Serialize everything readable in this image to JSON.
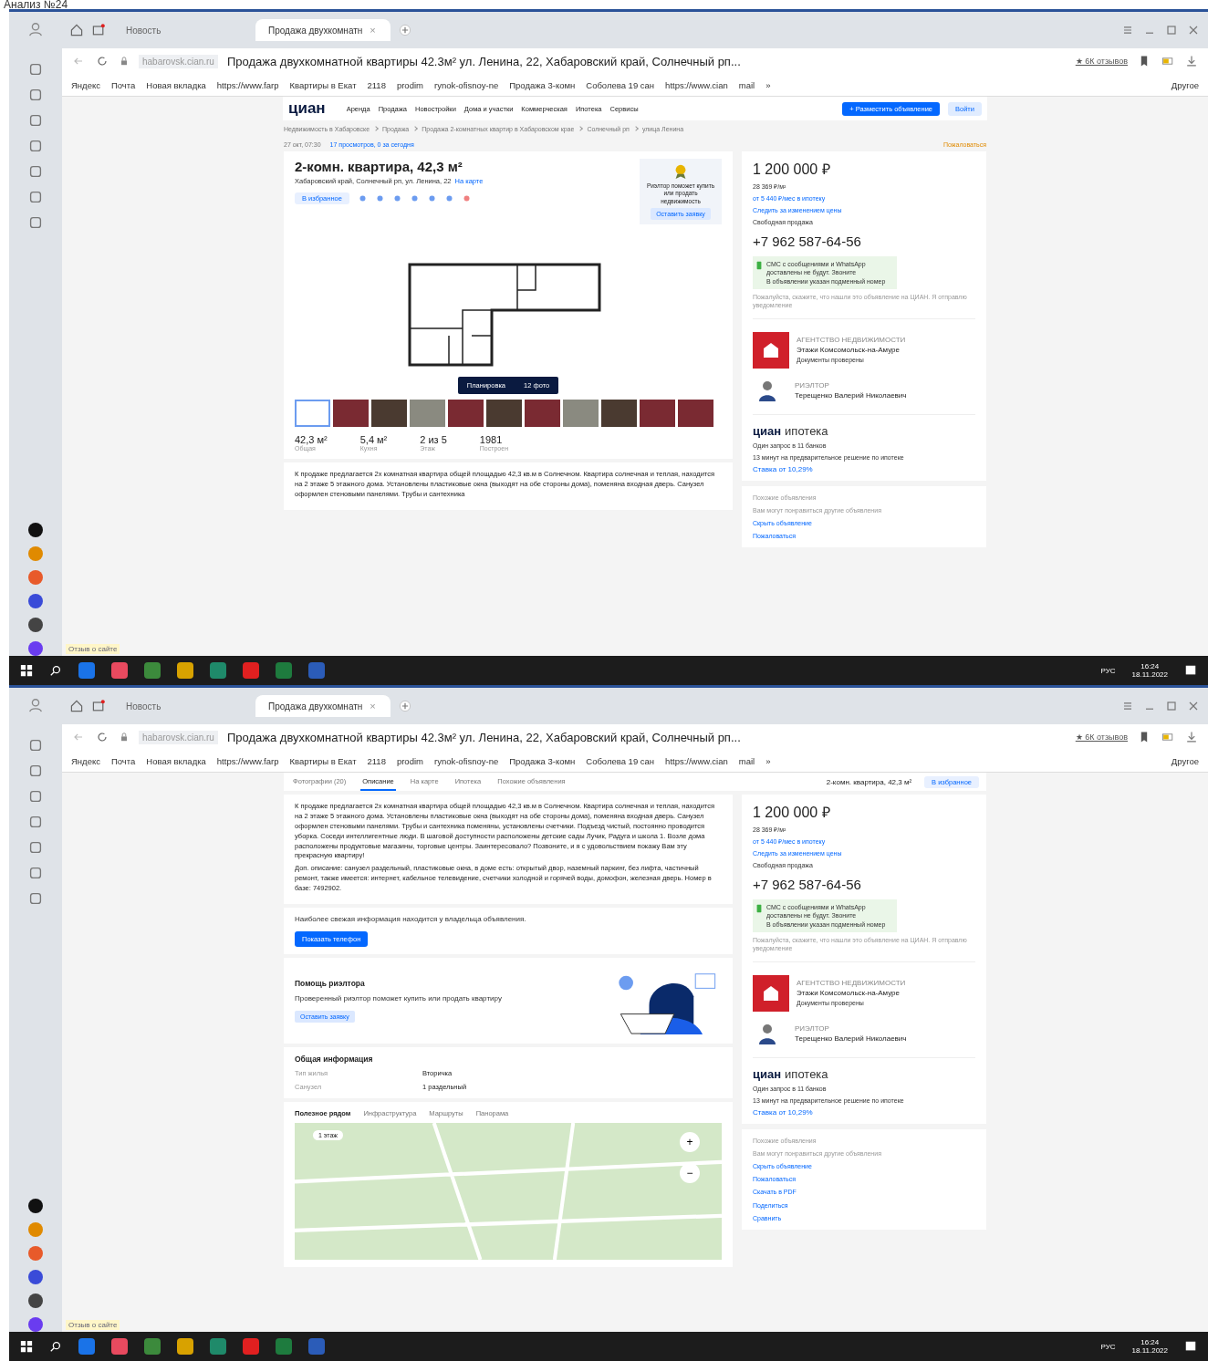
{
  "caption": "Анализ №24",
  "screens": [
    {
      "browser": {
        "tabs": [
          {
            "label": "Новость",
            "selected": false
          },
          {
            "label": "Продажа двухкомнатн",
            "selected": true,
            "close": "×"
          }
        ],
        "domain": "habarovsk.cian.ru",
        "page_title": "Продажа двухкомнатной квартиры 42.3м² ул. Ленина, 22, Хабаровский край, Солнечный рп...",
        "reviews": "★ 6К отзывов",
        "bookmarks": [
          "Яндекс",
          "Почта",
          "Новая вкладка",
          "https://www.farp",
          "Квартиры в Екат",
          "2118",
          "prodim",
          "rynok-ofisnoy-ne",
          "Продажа 3-комн",
          "Соболева 19 сан",
          "https://www.cian",
          "mail"
        ],
        "more": "»",
        "other": "Другое"
      },
      "feedback": "Отзыв о сайте",
      "page": {
        "kind": "overview",
        "header": {
          "logo": "циан",
          "nav": [
            "Аренда",
            "Продажа",
            "Новостройки",
            "Дома и участки",
            "Коммерческая",
            "Ипотека",
            "Сервисы"
          ],
          "post": "+ Разместить объявление",
          "login": "Войти"
        },
        "breadcrumbs": [
          "Недвижимость в Хабаровске",
          "Продажа",
          "Продажа 2-комнатных квартир в Хабаровском крае",
          "Солнечный рп",
          "улица Ленина"
        ],
        "meta": {
          "date": "27 окт, 07:30",
          "views": "17 просмотров, 0 за сегодня",
          "report": "Пожаловаться"
        },
        "title": "2-комн. квартира, 42,3 м²",
        "address": "Хабаровский край, Солнечный рп, ул. Ленина, 22",
        "map_link": "На карте",
        "favorite": "В избранное",
        "promo": {
          "text": "Риэлтор поможет купить или продать недвижимость",
          "button": "Оставить заявку"
        },
        "gallery": {
          "plan": "Планировка",
          "photos": "12 фото",
          "thumbs": [
            {
              "kind": "plan",
              "selected": true
            },
            {
              "kind": "photo",
              "selected": false
            },
            {
              "kind": "photo",
              "selected": false
            },
            {
              "kind": "photo",
              "selected": false
            },
            {
              "kind": "photo",
              "selected": false
            },
            {
              "kind": "photo",
              "selected": false
            },
            {
              "kind": "photo",
              "selected": false
            },
            {
              "kind": "photo",
              "selected": false
            },
            {
              "kind": "photo",
              "selected": false
            },
            {
              "kind": "photo",
              "selected": false
            },
            {
              "kind": "photo",
              "selected": false
            }
          ]
        },
        "stats": [
          {
            "value": "42,3 м²",
            "label": "Общая"
          },
          {
            "value": "5,4 м²",
            "label": "Кухня"
          },
          {
            "value": "2 из 5",
            "label": "Этаж"
          },
          {
            "value": "1981",
            "label": "Построен"
          }
        ],
        "description": "К продаже предлагается 2х комнатная квартира общей площадью 42,3 кв.м в Солнечном. Квартира солнечная и теплая, находится на 2 этаже 5 этажного дома. Установлены пластиковые окна (выходят на обе стороны дома), поменяна входная дверь. Санузел оформлен стеновыми панелями. Трубы и сантехника"
      },
      "offer": {
        "price": "1 200 000 ₽",
        "price_per_m": "28 369 ₽/м²",
        "mortgage": "от 5 440 ₽/мес в ипотеку",
        "watch": "Следить за изменением цены",
        "sale_type": "Свободная продажа",
        "phone": "+7 962 587-64-56",
        "sms_note": "СМС с сообщениями и WhatsApp доставлены не будут. Звоните",
        "sms_sub": "В объявлении указан подменный номер",
        "hint": "Пожалуйста, скажите, что нашли это объявление на ЦИАН. Я отправлю уведомление",
        "agency_label": "АГЕНТСТВО НЕДВИЖИМОСТИ",
        "agency": "Этажи Комсомольск-на-Амуре",
        "verified": "Документы проверены",
        "realtor_label": "РИЭЛТОР",
        "realtor": "Терещенко Валерий Николаевич",
        "mortgage_brand": "циан",
        "mortgage_word": "ипотека",
        "mortgage_lines": [
          "Один запрос в 11 банков",
          "13 минут на предварительное решение по ипотеке"
        ],
        "rate": "Ставка от 10,29%"
      },
      "more_panel": {
        "title": "Похожие объявления",
        "subtitle": "Вам могут понравиться другие объявления",
        "items": [
          "Скрыть объявление",
          "Пожаловаться"
        ]
      },
      "taskbar": {
        "lang": "РУС",
        "time": "16:24",
        "date": "18.11.2022"
      }
    },
    {
      "browser": {
        "tabs": [
          {
            "label": "Новость",
            "selected": false
          },
          {
            "label": "Продажа двухкомнатн",
            "selected": true,
            "close": "×"
          }
        ],
        "domain": "habarovsk.cian.ru",
        "page_title": "Продажа двухкомнатной квартиры 42.3м² ул. Ленина, 22, Хабаровский край, Солнечный рп...",
        "reviews": "★ 6К отзывов",
        "bookmarks": [
          "Яндекс",
          "Почта",
          "Новая вкладка",
          "https://www.farp",
          "Квартиры в Екат",
          "2118",
          "prodim",
          "rynok-ofisnoy-ne",
          "Продажа 3-комн",
          "Соболева 19 сан",
          "https://www.cian",
          "mail"
        ],
        "more": "»",
        "other": "Другое"
      },
      "feedback": "Отзыв о сайте",
      "page": {
        "kind": "details",
        "tabs": [
          {
            "label": "Фотографии (20)",
            "selected": false
          },
          {
            "label": "Описание",
            "selected": true
          },
          {
            "label": "На карте",
            "selected": false
          },
          {
            "label": "Ипотека",
            "selected": false
          },
          {
            "label": "Похожие объявления",
            "selected": false
          }
        ],
        "sticky_title": "2-комн. квартира, 42,3 м²",
        "favorite": "В избранное",
        "description": [
          "К продаже предлагается 2х комнатная квартира общей площадью 42,3 кв.м в Солнечном. Квартира солнечная и теплая, находится на 2 этаже 5 этажного дома. Установлены пластиковые окна (выходят на обе стороны дома), поменяна входная дверь. Санузел оформлен стеновыми панелями. Трубы и сантехника поменяны, установлены счетчики. Подъезд чистый, постоянно проводится уборка. Соседи интеллигентные люди. В шаговой доступности расположены детские сады Лучик, Радуга и школа 1. Возле дома расположены продуктовые магазины, торговые центры. Заинтересовало? Позвоните, и я с удовольствием покажу Вам эту прекрасную квартиру!",
          "Доп. описание: санузел раздельный, пластиковые окна, в доме есть: открытый двор, наземный паркинг, без лифта, частичный ремонт, также имеется: интернет, кабельное телевидение, счетчики холодной и горячей воды, домофон, железная дверь. Номер в базе: 7492902."
        ],
        "contact": {
          "text": "Наиболее свежая информация находится у владельца объявления.",
          "button": "Показать телефон"
        },
        "promo": {
          "title": "Помощь риэлтора",
          "text": "Проверенный риэлтор поможет купить или продать квартиру",
          "button": "Оставить заявку"
        },
        "info": {
          "title": "Общая информация",
          "rows": [
            {
              "label": "Тип жилья",
              "value": "Вторичка"
            },
            {
              "label": "Санузел",
              "value": "1 раздельный"
            }
          ]
        },
        "map_tabs": [
          {
            "label": "Полезное рядом",
            "selected": true
          },
          {
            "label": "Инфраструктура",
            "selected": false
          },
          {
            "label": "Маршруты",
            "selected": false
          },
          {
            "label": "Панорама",
            "selected": false
          }
        ],
        "map": {
          "chip": "1 этаж",
          "zoom_in": "+",
          "zoom_out": "−"
        }
      },
      "offer": {
        "price": "1 200 000 ₽",
        "price_per_m": "28 369 ₽/м²",
        "mortgage": "от 5 440 ₽/мес в ипотеку",
        "watch": "Следить за изменением цены",
        "sale_type": "Свободная продажа",
        "phone": "+7 962 587-64-56",
        "sms_note": "СМС с сообщениями и WhatsApp доставлены не будут. Звоните",
        "sms_sub": "В объявлении указан подменный номер",
        "hint": "Пожалуйста, скажите, что нашли это объявление на ЦИАН. Я отправлю уведомление",
        "agency_label": "АГЕНТСТВО НЕДВИЖИМОСТИ",
        "agency": "Этажи Комсомольск-на-Амуре",
        "verified": "Документы проверены",
        "realtor_label": "РИЭЛТОР",
        "realtor": "Терещенко Валерий Николаевич",
        "mortgage_brand": "циан",
        "mortgage_word": "ипотека",
        "mortgage_lines": [
          "Один запрос в 11 банков",
          "13 минут на предварительное решение по ипотеке"
        ],
        "rate": "Ставка от 10,29%"
      },
      "more_panel": {
        "title": "Похожие объявления",
        "subtitle": "Вам могут понравиться другие объявления",
        "items": [
          "Скрыть объявление",
          "Пожаловаться",
          "Скачать в PDF",
          "Поделиться",
          "Сравнить"
        ]
      },
      "taskbar": {
        "lang": "РУС",
        "time": "16:24",
        "date": "18.11.2022"
      }
    }
  ]
}
